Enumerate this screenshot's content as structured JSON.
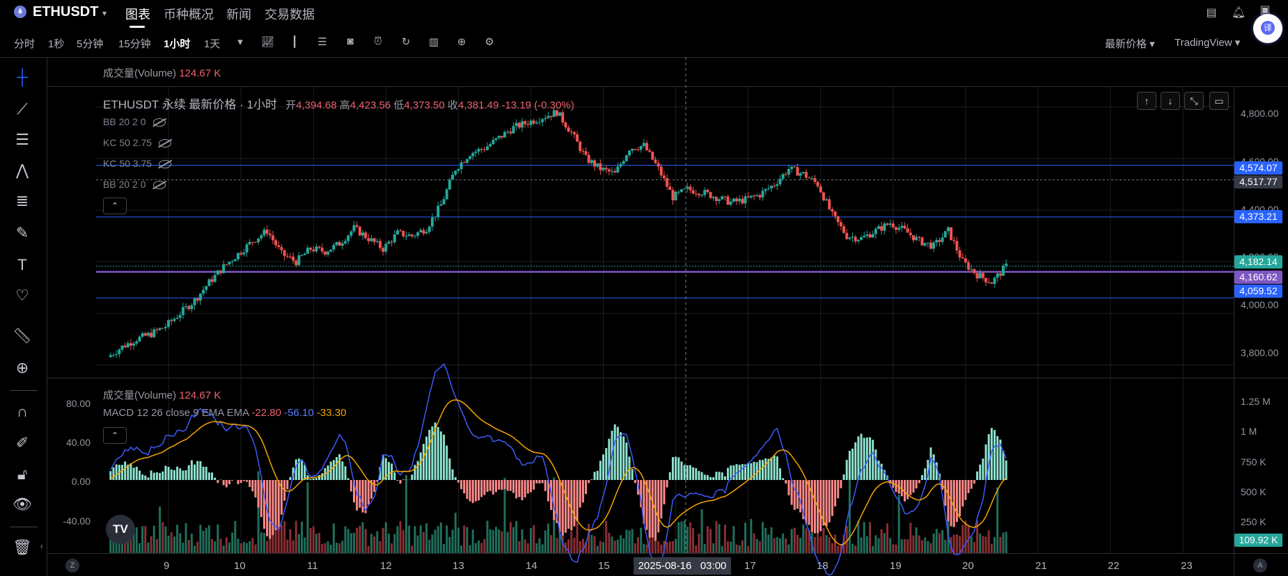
{
  "header": {
    "symbol": "ETHUSDT",
    "nav": [
      "图表",
      "币种概况",
      "新闻",
      "交易数据"
    ],
    "translate_label": "译"
  },
  "toolbar": {
    "intervals": [
      "分时",
      "1秒",
      "5分钟",
      "15分钟",
      "1小时",
      "1天"
    ],
    "active_interval": "1小时",
    "price_type": "最新价格",
    "chart_engine": "TradingView"
  },
  "left_tools": [
    "crosshair-icon",
    "trendline-icon",
    "fib-icon",
    "pattern-icon",
    "projection-icon",
    "brush-icon",
    "text-icon",
    "heart-icon",
    "ruler-icon",
    "zoom-in-icon",
    "magnet-icon",
    "lock-edit-icon",
    "lock-icon",
    "eye-icon",
    "trash-icon"
  ],
  "volume_legend": {
    "label": "成交量(Volume)",
    "value": "124.67 K"
  },
  "main_legend": {
    "title": "ETHUSDT 永续 最新价格 · 1小时",
    "open_label": "开",
    "open": "4,394.68",
    "high_label": "高",
    "high": "4,423.56",
    "low_label": "低",
    "low": "4,373.50",
    "close_label": "收",
    "close": "4,381.49",
    "change": "-13.19 (-0.30%)"
  },
  "indicators": [
    "BB 20 2 0",
    "KC 50 2.75",
    "KC 50 3.75",
    "BB 20 2 0"
  ],
  "lower_legend": {
    "volume_label": "成交量(Volume)",
    "volume_value": "124.67 K",
    "macd_label": "MACD 12 26 close 9 EMA EMA",
    "macd": "-22.80",
    "signal": "-56.10",
    "hist": "-33.30"
  },
  "price_axis": {
    "ticks": [
      "4,800.00",
      "4,600.00",
      "4,400.00",
      "4,200.00",
      "4,000.00",
      "3,800.00"
    ],
    "labels": [
      {
        "text": "4,574.07",
        "color": "#2962ff"
      },
      {
        "text": "4,517.77",
        "color": "#363a45"
      },
      {
        "text": "4,373.21",
        "color": "#2962ff"
      },
      {
        "text": "4,182.14",
        "color": "#26a69a"
      },
      {
        "text": "4,160.62",
        "color": "#7e57c2"
      },
      {
        "text": "4,059.52",
        "color": "#2962ff"
      }
    ]
  },
  "volume_axis": {
    "ticks": [
      "1.25 M",
      "1 M",
      "750 K",
      "500 K",
      "250 K"
    ],
    "current": "109.92 K"
  },
  "macd_axis": {
    "ticks": [
      "80.00",
      "40.00",
      "0.00",
      "-40.00"
    ]
  },
  "time_axis": {
    "ticks": [
      "9",
      "10",
      "11",
      "12",
      "13",
      "14",
      "15",
      "17",
      "18",
      "19",
      "20",
      "21",
      "22",
      "23"
    ],
    "crosshair_date": "2025-08-16",
    "crosshair_time": "03:00"
  },
  "corner_buttons": {
    "left": "Z",
    "right": "A"
  },
  "chart_data": {
    "type": "candlestick",
    "symbol": "ETHUSDT",
    "interval": "1小时",
    "x_days": [
      8.2,
      8.4,
      8.6,
      8.8,
      9.0,
      9.2,
      9.4,
      9.6,
      9.8,
      10.0,
      10.2,
      10.4,
      10.6,
      10.8,
      11.0,
      11.2,
      11.4,
      11.6,
      11.8,
      12.0,
      12.2,
      12.4,
      12.6,
      12.8,
      13.0,
      13.2,
      13.4,
      13.6,
      13.8,
      14.0,
      14.2,
      14.4,
      14.6,
      14.8,
      15.0,
      15.2,
      15.4,
      15.6,
      15.8,
      16.0,
      16.2,
      16.4,
      16.6,
      16.8,
      17.0,
      17.2,
      17.4,
      17.6,
      17.8,
      18.0,
      18.2,
      18.4,
      18.6,
      18.8,
      19.0,
      19.2,
      19.4,
      19.6,
      19.8,
      20.0,
      20.2,
      20.4,
      20.6
    ],
    "close": [
      3830,
      3870,
      3900,
      3920,
      3950,
      4000,
      4050,
      4120,
      4180,
      4230,
      4280,
      4320,
      4230,
      4200,
      4250,
      4240,
      4270,
      4330,
      4290,
      4250,
      4310,
      4300,
      4330,
      4420,
      4560,
      4620,
      4640,
      4680,
      4720,
      4740,
      4760,
      4780,
      4700,
      4600,
      4560,
      4540,
      4640,
      4650,
      4560,
      4450,
      4480,
      4470,
      4450,
      4430,
      4440,
      4460,
      4500,
      4560,
      4540,
      4500,
      4380,
      4300,
      4290,
      4320,
      4350,
      4320,
      4280,
      4260,
      4320,
      4200,
      4150,
      4120,
      4182
    ],
    "ylim": [
      3750,
      4880
    ],
    "xlim": [
      8,
      23.7
    ],
    "macd": {
      "macd": -22.8,
      "signal": -56.1,
      "hist": -33.3,
      "ylim": [
        -60,
        100
      ]
    },
    "volume_ylim_k": [
      0,
      1400
    ]
  }
}
